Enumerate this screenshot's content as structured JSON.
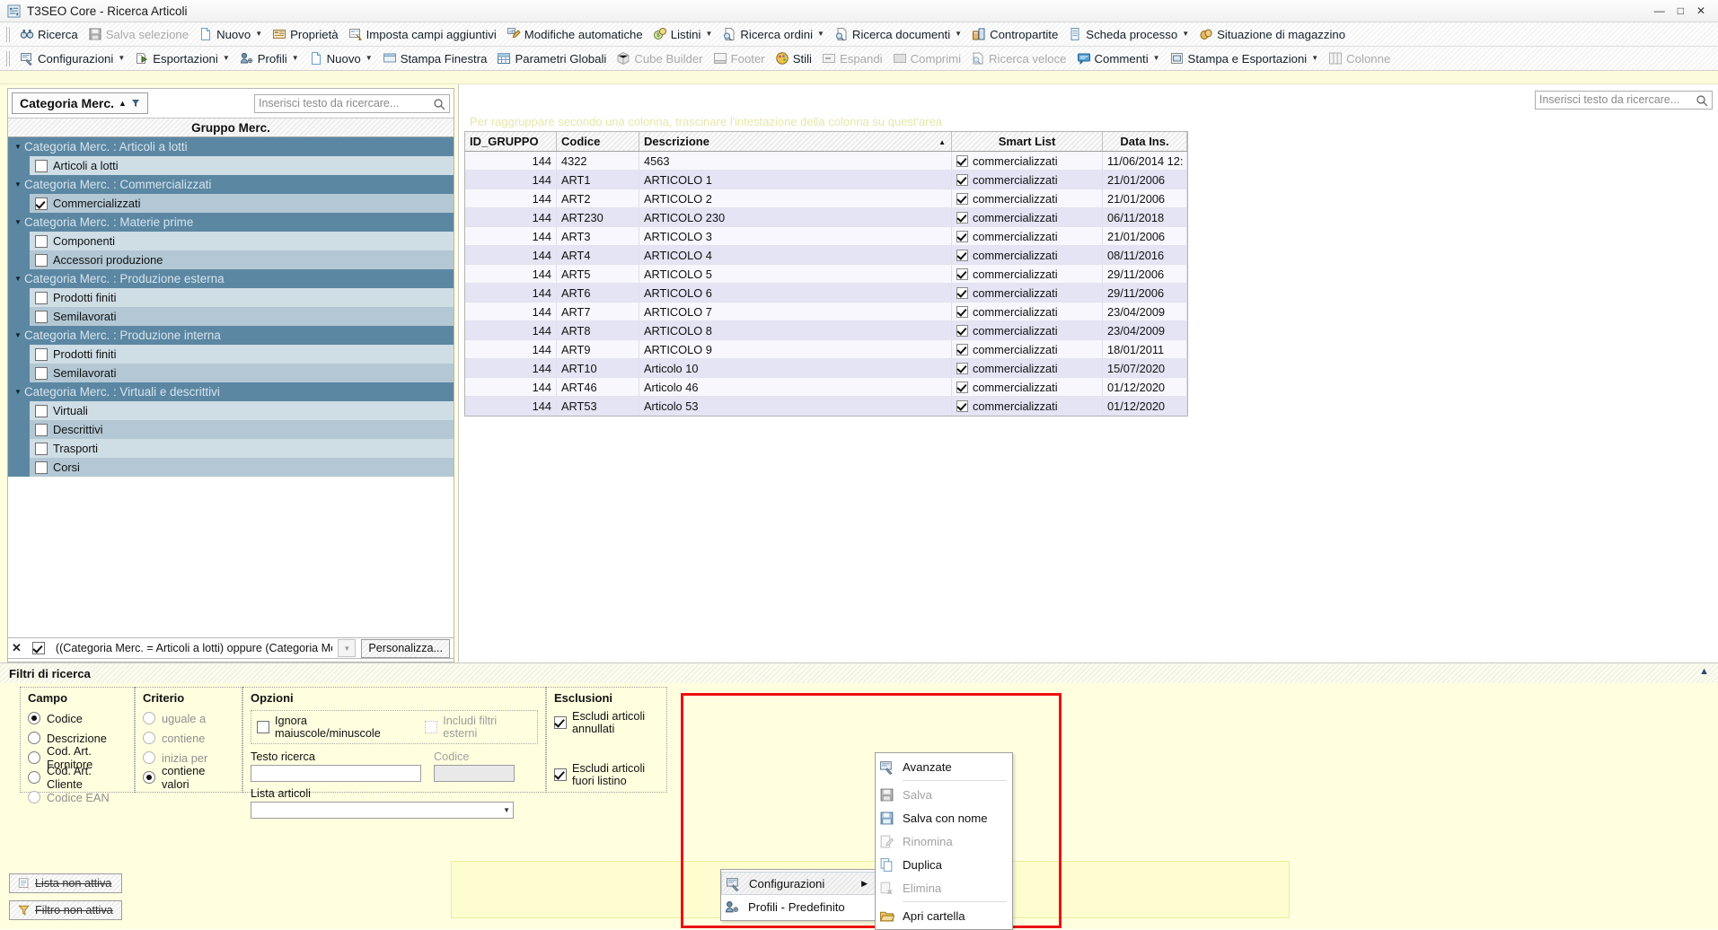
{
  "window": {
    "title": "T3SEO Core - Ricerca Articoli",
    "icon": "app-icon",
    "buttons": [
      "minimize",
      "maximize",
      "close"
    ],
    "minimize_glyph": "—",
    "maximize_glyph": "□",
    "close_glyph": "✕"
  },
  "toolbar1": [
    {
      "label": "Ricerca",
      "icon": "binoculars-icon",
      "disabled": false,
      "dropdown": false
    },
    {
      "label": "Salva selezione",
      "icon": "save-icon",
      "disabled": true,
      "dropdown": false
    },
    {
      "label": "Nuovo",
      "icon": "new-document-icon",
      "disabled": false,
      "dropdown": true
    },
    {
      "label": "Proprietà",
      "icon": "properties-icon",
      "disabled": false,
      "dropdown": false
    },
    {
      "label": "Imposta campi aggiuntivi",
      "icon": "set-fields-icon",
      "disabled": false,
      "dropdown": false
    },
    {
      "label": "Modifiche automatiche",
      "icon": "auto-edit-icon",
      "disabled": false,
      "dropdown": false
    },
    {
      "label": "Listini",
      "icon": "pricelist-icon",
      "disabled": false,
      "dropdown": true
    },
    {
      "label": "Ricerca ordini",
      "icon": "search-orders-icon",
      "disabled": false,
      "dropdown": true
    },
    {
      "label": "Ricerca documenti",
      "icon": "search-docs-icon",
      "disabled": false,
      "dropdown": true
    },
    {
      "label": "Contropartite",
      "icon": "contropartite-icon",
      "disabled": false,
      "dropdown": false
    },
    {
      "label": "Scheda processo",
      "icon": "process-sheet-icon",
      "disabled": false,
      "dropdown": true
    },
    {
      "label": "Situazione di magazzino",
      "icon": "warehouse-icon",
      "disabled": false,
      "dropdown": false
    }
  ],
  "toolbar2": [
    {
      "label": "Configurazioni",
      "icon": "configurations-icon",
      "disabled": false,
      "dropdown": true
    },
    {
      "label": "Esportazioni",
      "icon": "export-icon",
      "disabled": false,
      "dropdown": true
    },
    {
      "label": "Profili",
      "icon": "profiles-icon",
      "disabled": false,
      "dropdown": true
    },
    {
      "label": "Nuovo",
      "icon": "new-document-icon",
      "disabled": false,
      "dropdown": true
    },
    {
      "label": "Stampa Finestra",
      "icon": "print-window-icon",
      "disabled": false,
      "dropdown": false
    },
    {
      "label": "Parametri Globali",
      "icon": "global-params-icon",
      "disabled": false,
      "dropdown": false
    },
    {
      "label": "Cube Builder",
      "icon": "cube-builder-icon",
      "disabled": true,
      "dropdown": false
    },
    {
      "label": "Footer",
      "icon": "footer-icon",
      "disabled": true,
      "dropdown": false
    },
    {
      "label": "Stili",
      "icon": "styles-icon",
      "disabled": false,
      "dropdown": false
    },
    {
      "label": "Espandi",
      "icon": "expand-icon",
      "disabled": true,
      "dropdown": false
    },
    {
      "label": "Comprimi",
      "icon": "collapse-icon",
      "disabled": true,
      "dropdown": false
    },
    {
      "label": "Ricerca veloce",
      "icon": "quick-search-icon",
      "disabled": true,
      "dropdown": false
    },
    {
      "label": "Commenti",
      "icon": "comments-icon",
      "disabled": false,
      "dropdown": true
    },
    {
      "label": "Stampa e Esportazioni",
      "icon": "print-export-icon",
      "disabled": false,
      "dropdown": true
    },
    {
      "label": "Colonne",
      "icon": "columns-icon",
      "disabled": true,
      "dropdown": false
    }
  ],
  "left_panel": {
    "category_button": "Categoria Merc.",
    "category_sort_glyph": "▲",
    "search_placeholder": "Inserisci testo da ricercare...",
    "group_header": "Gruppo Merc.",
    "tree": [
      {
        "group": "Categoria Merc. : Articoli a lotti",
        "items": [
          {
            "label": "Articoli a lotti",
            "checked": false
          }
        ]
      },
      {
        "group": "Categoria Merc. : Commercializzati",
        "items": [
          {
            "label": "Commercializzati",
            "checked": true
          }
        ]
      },
      {
        "group": "Categoria Merc. : Materie prime",
        "items": [
          {
            "label": "Componenti",
            "checked": false
          },
          {
            "label": "Accessori produzione",
            "checked": false
          }
        ]
      },
      {
        "group": "Categoria Merc. : Produzione esterna",
        "items": [
          {
            "label": "Prodotti finiti",
            "checked": false
          },
          {
            "label": "Semilavorati",
            "checked": false
          }
        ]
      },
      {
        "group": "Categoria Merc. : Produzione interna",
        "items": [
          {
            "label": "Prodotti finiti",
            "checked": false
          },
          {
            "label": "Semilavorati",
            "checked": false
          }
        ]
      },
      {
        "group": "Categoria Merc. : Virtuali e descrittivi",
        "items": [
          {
            "label": "Virtuali",
            "checked": false
          },
          {
            "label": "Descrittivi",
            "checked": false
          },
          {
            "label": "Trasporti",
            "checked": false
          },
          {
            "label": "Corsi",
            "checked": false
          }
        ]
      }
    ],
    "filter_bar": {
      "close_glyph": "✕",
      "enabled": true,
      "expression": "((Categoria Merc. = Articoli a lotti) oppure (Categoria Merc. = Comm",
      "dropdown_glyph": "▼",
      "customize_label": "Personalizza..."
    }
  },
  "grid": {
    "search_placeholder": "Inserisci testo da ricercare...",
    "group_hint": "Per raggruppare secondo una colonna, trascinare l'intestazione della colonna su quest'area",
    "columns": [
      "ID_GRUPPO",
      "Codice",
      "Descrizione",
      "Smart List",
      "Data Ins."
    ],
    "sorted_column": "Descrizione",
    "sort_glyph": "▲",
    "rows": [
      {
        "id_gruppo": "144",
        "codice": "4322",
        "descrizione": "4563",
        "smart_list": "commercializzati",
        "data_ins": "11/06/2014 12:"
      },
      {
        "id_gruppo": "144",
        "codice": "ART1",
        "descrizione": "ARTICOLO 1",
        "smart_list": "commercializzati",
        "data_ins": "21/01/2006"
      },
      {
        "id_gruppo": "144",
        "codice": "ART2",
        "descrizione": "ARTICOLO 2",
        "smart_list": "commercializzati",
        "data_ins": "21/01/2006"
      },
      {
        "id_gruppo": "144",
        "codice": "ART230",
        "descrizione": "ARTICOLO 230",
        "smart_list": "commercializzati",
        "data_ins": "06/11/2018"
      },
      {
        "id_gruppo": "144",
        "codice": "ART3",
        "descrizione": "ARTICOLO 3",
        "smart_list": "commercializzati",
        "data_ins": "21/01/2006"
      },
      {
        "id_gruppo": "144",
        "codice": "ART4",
        "descrizione": "ARTICOLO 4",
        "smart_list": "commercializzati",
        "data_ins": "08/11/2016"
      },
      {
        "id_gruppo": "144",
        "codice": "ART5",
        "descrizione": "ARTICOLO 5",
        "smart_list": "commercializzati",
        "data_ins": "29/11/2006"
      },
      {
        "id_gruppo": "144",
        "codice": "ART6",
        "descrizione": "ARTICOLO 6",
        "smart_list": "commercializzati",
        "data_ins": "29/11/2006"
      },
      {
        "id_gruppo": "144",
        "codice": "ART7",
        "descrizione": "ARTICOLO 7",
        "smart_list": "commercializzati",
        "data_ins": "23/04/2009"
      },
      {
        "id_gruppo": "144",
        "codice": "ART8",
        "descrizione": "ARTICOLO 8",
        "smart_list": "commercializzati",
        "data_ins": "23/04/2009"
      },
      {
        "id_gruppo": "144",
        "codice": "ART9",
        "descrizione": "ARTICOLO 9",
        "smart_list": "commercializzati",
        "data_ins": "18/01/2011"
      },
      {
        "id_gruppo": "144",
        "codice": "ART10",
        "descrizione": "Articolo 10",
        "smart_list": "commercializzati",
        "data_ins": "15/07/2020"
      },
      {
        "id_gruppo": "144",
        "codice": "ART46",
        "descrizione": "Articolo 46",
        "smart_list": "commercializzati",
        "data_ins": "01/12/2020"
      },
      {
        "id_gruppo": "144",
        "codice": "ART53",
        "descrizione": "Articolo 53",
        "smart_list": "commercializzati",
        "data_ins": "01/12/2020"
      }
    ]
  },
  "search_panel": {
    "title": "Filtri di ricerca",
    "collapse_glyph": "▲",
    "campo": {
      "title": "Campo",
      "options": [
        {
          "label": "Codice",
          "selected": true,
          "disabled": false
        },
        {
          "label": "Descrizione",
          "selected": false,
          "disabled": false
        },
        {
          "label": "Cod. Art. Fornitore",
          "selected": false,
          "disabled": false
        },
        {
          "label": "Cod. Art. Cliente",
          "selected": false,
          "disabled": false
        },
        {
          "label": "Codice EAN",
          "selected": false,
          "disabled": true
        }
      ]
    },
    "criterio": {
      "title": "Criterio",
      "options": [
        {
          "label": "uguale a",
          "selected": false,
          "disabled": true
        },
        {
          "label": "contiene",
          "selected": false,
          "disabled": true
        },
        {
          "label": "inizia per",
          "selected": false,
          "disabled": true
        },
        {
          "label": "contiene valori",
          "selected": true,
          "disabled": false
        }
      ]
    },
    "opzioni": {
      "title": "Opzioni",
      "ignore_case": {
        "label": "Ignora maiuscole/minuscole",
        "checked": false,
        "disabled": false
      },
      "include_external": {
        "label": "Includi filtri esterni",
        "checked": false,
        "disabled": true
      },
      "testo_ricerca_label": "Testo ricerca",
      "testo_ricerca_value": "",
      "codice_label": "Codice",
      "codice_value": "",
      "lista_articoli_label": "Lista articoli",
      "lista_articoli_value": "",
      "lista_dropdown_glyph": "▼"
    },
    "esclusioni": {
      "title": "Esclusioni",
      "options": [
        {
          "label": "Escludi articoli annullati",
          "checked": true
        },
        {
          "label": "Escludi articoli fuori listino",
          "checked": true
        }
      ]
    },
    "status_buttons": [
      {
        "label": "Lista non attiva",
        "icon": "list-inactive-icon"
      },
      {
        "label": "Filtro non attiva",
        "icon": "filter-inactive-icon"
      }
    ]
  },
  "context_menu_left": [
    {
      "label": "Configurazioni",
      "icon": "configurations-icon",
      "disabled": false,
      "submenu": true,
      "highlighted": true
    },
    {
      "label": "Profili - Predefinito",
      "icon": "profiles-icon",
      "disabled": false,
      "submenu": false,
      "highlighted": false
    }
  ],
  "context_menu_right": [
    {
      "label": "Avanzate",
      "icon": "advanced-icon",
      "disabled": false,
      "sep_after": true
    },
    {
      "label": "Salva",
      "icon": "save-icon",
      "disabled": true,
      "sep_after": false
    },
    {
      "label": "Salva con nome",
      "icon": "save-as-icon",
      "disabled": false,
      "sep_after": false
    },
    {
      "label": "Rinomina",
      "icon": "rename-icon",
      "disabled": true,
      "sep_after": false
    },
    {
      "label": "Duplica",
      "icon": "duplicate-icon",
      "disabled": false,
      "sep_after": false
    },
    {
      "label": "Elimina",
      "icon": "delete-icon",
      "disabled": true,
      "sep_after": true
    },
    {
      "label": "Apri cartella",
      "icon": "open-folder-icon",
      "disabled": false,
      "sep_after": false
    }
  ],
  "colors": {
    "group_row": "#5b87a3",
    "row_light": "#cfdde5",
    "row_dark": "#b3c8d4",
    "grid_odd": "#f7f7fd",
    "grid_even": "#e4e4f4",
    "panel_yellow": "#ffffe0",
    "highlight_red": "#ee1111"
  }
}
